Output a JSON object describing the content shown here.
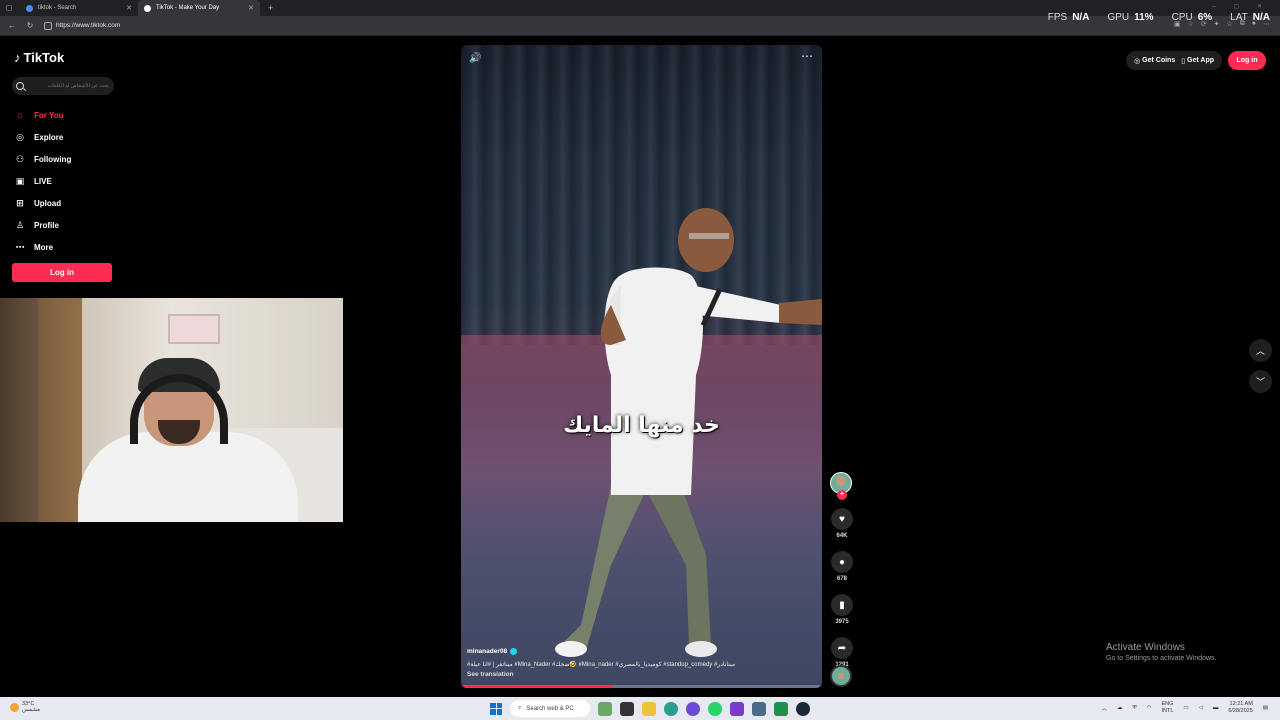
{
  "browser": {
    "tabs": [
      {
        "title": "tiktok - Search",
        "active": false
      },
      {
        "title": "TikTok - Make Your Day",
        "active": true
      }
    ],
    "new_tab": "+",
    "url": "https://www.tiktok.com"
  },
  "overlay": {
    "fps_label": "FPS",
    "fps_value": "N/A",
    "gpu_label": "GPU",
    "gpu_value": "11%",
    "cpu_label": "CPU",
    "cpu_value": "6%",
    "lat_label": "LAT",
    "lat_value": "N/A"
  },
  "sidebar": {
    "logo": "TikTok",
    "search_placeholder": "بحث عن الأشخاص أو الكلمات",
    "items": [
      {
        "label": "For You",
        "icon": "home-icon",
        "active": true
      },
      {
        "label": "Explore",
        "icon": "compass-icon",
        "active": false
      },
      {
        "label": "Following",
        "icon": "following-icon",
        "active": false
      },
      {
        "label": "LIVE",
        "icon": "live-icon",
        "active": false
      },
      {
        "label": "Upload",
        "icon": "upload-icon",
        "active": false
      },
      {
        "label": "Profile",
        "icon": "profile-icon",
        "active": false
      },
      {
        "label": "More",
        "icon": "more-icon",
        "active": false
      }
    ],
    "login": "Log in"
  },
  "video": {
    "caption": "خد منها المايك",
    "author": "minanader08",
    "tags": "#ميناتفر | #انا عيلة  #Mina_Nader  #ضحك🤣  #Mina_nader  #كوميديا_بالمصري  #standup_comedy  #مينانادر",
    "see_translation": "See translation",
    "progress": 0.42
  },
  "actions": {
    "likes": "64K",
    "comments": "678",
    "saves": "3975",
    "shares": "1291"
  },
  "topright": {
    "get_coins": "Get Coins",
    "get_app": "Get App",
    "login": "Log in"
  },
  "watermark": {
    "line1": "Activate Windows",
    "line2": "Go to Settings to activate Windows."
  },
  "taskbar": {
    "weather_temp": "33°C",
    "weather_desc": "مشمس",
    "search_placeholder": "Search web & PC",
    "lang": "ENG",
    "lang_sub": "INTL",
    "time": "12:21 AM",
    "date": "6/28/2025"
  },
  "colors": {
    "accent": "#fe2c55",
    "bg": "#000000",
    "pill": "#1f1f1f"
  }
}
